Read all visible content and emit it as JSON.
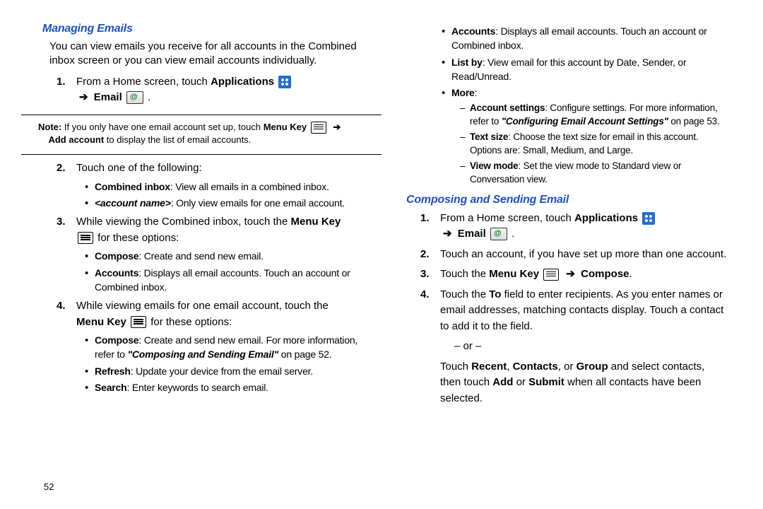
{
  "left": {
    "h1": "Managing Emails",
    "intro": "You can view emails you receive for all accounts in the Combined inbox screen or you can view email accounts individually.",
    "step1_a": "From a Home screen, touch ",
    "step1_apps": "Applications",
    "step1_email": "Email",
    "note_lead": "Note:",
    "note_a": " If you only have one email account set up, touch ",
    "note_menu": "Menu Key",
    "note_b": "Add account",
    "note_c": " to display the list of email accounts.",
    "step2": "Touch one of the following:",
    "s2_b1_b": "Combined inbox",
    "s2_b1_t": ": View all emails in a combined inbox.",
    "s2_b2_b": "<account name>",
    "s2_b2_t": ": Only view emails for one email account.",
    "step3_a": "While viewing the Combined inbox, touch the ",
    "step3_menu": "Menu Key",
    "step3_b": " for these options:",
    "s3_b1_b": "Compose",
    "s3_b1_t": ": Create and send new email.",
    "s3_b2_b": "Accounts",
    "s3_b2_t": ": Displays all email accounts. Touch an account or Combined inbox.",
    "step4_a": "While viewing emails for one email account, touch the ",
    "step4_menu": "Menu Key",
    "step4_b": "  for these options:",
    "s4_b1_b": "Compose",
    "s4_b1_t": ": Create and send new email. For more information, refer to ",
    "s4_b1_ref": "\"Composing and Sending Email\"",
    "s4_b1_pg": "  on page 52.",
    "s4_b2_b": "Refresh",
    "s4_b2_t": ": Update your device from the email server.",
    "s4_b3_b": "Search",
    "s4_b3_t": ": Enter keywords to search email."
  },
  "right": {
    "top_b1_b": "Accounts",
    "top_b1_t": ": Displays all email accounts. Touch an account or Combined inbox.",
    "top_b2_b": "List by",
    "top_b2_t": ": View email for this account by Date, Sender, or Read/Unread.",
    "top_b3_b": "More",
    "top_b3_t": ":",
    "m1_b": "Account settings",
    "m1_t": ": Configure settings. For more information, refer to ",
    "m1_ref": "\"Configuring Email Account Settings\"",
    "m1_pg": "  on page 53.",
    "m2_b": "Text size",
    "m2_t": ": Choose the text size for email in this account. Options are: Small, Medium, and Large.",
    "m3_b": "View mode",
    "m3_t": ": Set the view mode to Standard view or Conversation view.",
    "h2": "Composing and Sending Email",
    "r1_a": "From a Home screen, touch ",
    "r1_apps": "Applications",
    "r1_email": "Email",
    "r2": "Touch an account, if you have set up more than one account.",
    "r3_a": "Touch the ",
    "r3_menu": "Menu Key",
    "r3_comp": "Compose",
    "r4_a": "Touch the ",
    "r4_to": "To",
    "r4_b": " field to enter recipients. As you enter names or email addresses, matching contacts display. Touch a contact to add it to the field.",
    "or": "– or –",
    "r4_c1": "Touch ",
    "r4_recent": "Recent",
    "r4_c2": ", ",
    "r4_contacts": "Contacts",
    "r4_c3": ", or ",
    "r4_group": "Group",
    "r4_c4": " and select contacts, then touch ",
    "r4_add": "Add",
    "r4_c5": " or ",
    "r4_submit": "Submit",
    "r4_c6": " when all contacts have been selected."
  },
  "page": "52"
}
